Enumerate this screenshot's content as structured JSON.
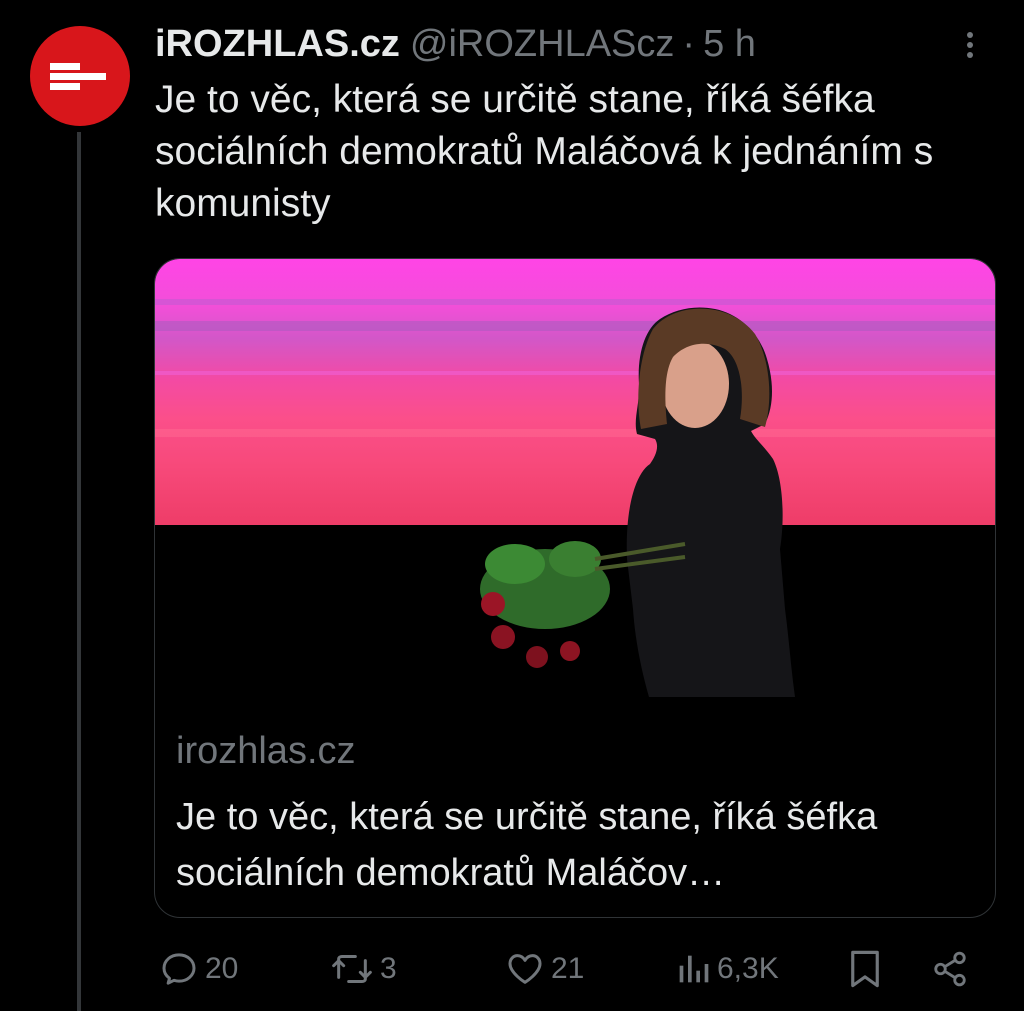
{
  "account": {
    "display_name": "iROZHLAS.cz",
    "handle": "@iROZHLAScz",
    "separator": "·",
    "time": "5 h",
    "avatar_icon": "irozhlas-logo-icon",
    "brand_color": "#d8161b"
  },
  "tweet": {
    "text": "Je to věc, která se určitě stane, říká šéfka sociálních demokratů Maláčová k jednáním s komunisty"
  },
  "card": {
    "domain": "irozhlas.cz",
    "title": "Je to věc, která se určitě stane, říká šéfka sociálních demokratů Maláčov…",
    "image_icon": "woman-with-roses-on-stage-photo"
  },
  "actions": {
    "replies": {
      "icon": "reply-icon",
      "count": "20"
    },
    "retweets": {
      "icon": "retweet-icon",
      "count": "3"
    },
    "likes": {
      "icon": "heart-icon",
      "count": "21"
    },
    "views": {
      "icon": "views-icon",
      "count": "6,3K"
    },
    "bookmark": {
      "icon": "bookmark-icon"
    },
    "share": {
      "icon": "share-icon"
    }
  },
  "colors": {
    "background": "#000000",
    "text": "#e7e9ea",
    "muted": "#71767b",
    "border": "#2f3336"
  }
}
